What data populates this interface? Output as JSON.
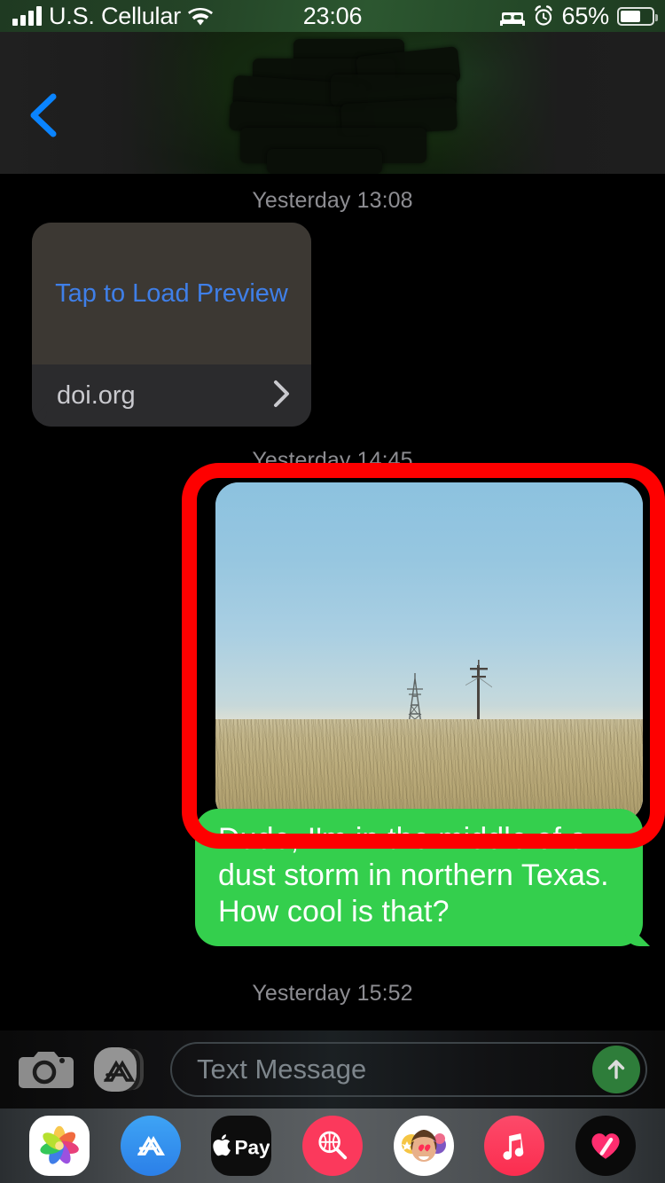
{
  "status_bar": {
    "carrier": "U.S. Cellular",
    "time": "23:06",
    "battery_percent": "65%",
    "battery_level": 65,
    "icons": [
      "signal-bars-icon",
      "wifi-icon",
      "bed-icon",
      "alarm-clock-icon",
      "battery-icon"
    ]
  },
  "nav_bar": {
    "back_icon": "chevron-left-icon",
    "back_color": "#0a84ff",
    "contact_name_redacted": true
  },
  "thread": {
    "timestamps": {
      "first": "Yesterday 13:08",
      "second": "Yesterday 14:45",
      "third": "Yesterday 15:52"
    },
    "link_preview": {
      "load_label": "Tap to Load Preview",
      "host": "doi.org",
      "chevron_icon": "chevron-right-icon",
      "link_color": "#3f7fe8"
    },
    "photo_message": {
      "alt": "prairie landscape with fence line, power tower and dry grass under hazy blue sky",
      "annotation_color": "#fe0000",
      "annotated": true
    },
    "green_message": {
      "text": "Dude, I'm in the middle of a dust storm in northern Texas. How cool is that?",
      "bubble_color": "#34cf4d",
      "text_color": "#ffffff"
    }
  },
  "input_bar": {
    "camera_icon": "camera-icon",
    "appstore_icon": "app-store-icon",
    "placeholder": "Text Message",
    "send_icon": "arrow-up-icon",
    "send_color": "#2e7d3a"
  },
  "app_drawer": {
    "apps": [
      {
        "name": "photos-app-icon",
        "label": "Photos"
      },
      {
        "name": "app-store-app-icon",
        "label": "App Store"
      },
      {
        "name": "apple-pay-app-icon",
        "label": "Apple Pay"
      },
      {
        "name": "images-app-icon",
        "label": "#images"
      },
      {
        "name": "memoji-app-icon",
        "label": "Memoji"
      },
      {
        "name": "apple-music-app-icon",
        "label": "Music"
      },
      {
        "name": "digital-touch-app-icon",
        "label": "Digital Touch"
      }
    ]
  }
}
